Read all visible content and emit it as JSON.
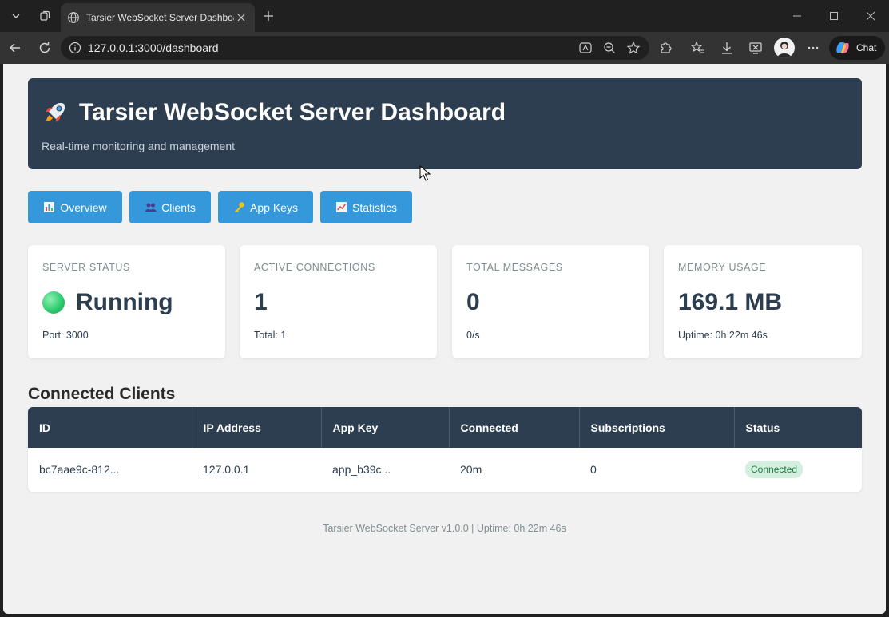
{
  "browser": {
    "tab_title": "Tarsier WebSocket Server Dashboard",
    "url": "127.0.0.1:3000/dashboard",
    "chat_label": "Chat"
  },
  "header": {
    "title": "Tarsier WebSocket Server Dashboard",
    "subtitle": "Real-time monitoring and management"
  },
  "nav": [
    {
      "label": "Overview",
      "icon": "bar-chart-icon"
    },
    {
      "label": "Clients",
      "icon": "users-icon"
    },
    {
      "label": "App Keys",
      "icon": "key-icon"
    },
    {
      "label": "Statistics",
      "icon": "trend-chart-icon"
    }
  ],
  "cards": [
    {
      "label": "SERVER STATUS",
      "value": "Running",
      "sub": "Port: 3000"
    },
    {
      "label": "ACTIVE CONNECTIONS",
      "value": "1",
      "sub": "Total: 1"
    },
    {
      "label": "TOTAL MESSAGES",
      "value": "0",
      "sub": "0/s"
    },
    {
      "label": "MEMORY USAGE",
      "value": "169.1 MB",
      "sub": "Uptime: 0h 22m 46s"
    }
  ],
  "clients": {
    "title": "Connected Clients",
    "columns": [
      "ID",
      "IP Address",
      "App Key",
      "Connected",
      "Subscriptions",
      "Status"
    ],
    "rows": [
      [
        "bc7aae9c-812...",
        "127.0.0.1",
        "app_b39c...",
        "20m",
        "0",
        "Connected"
      ]
    ]
  },
  "footer": "Tarsier WebSocket Server v1.0.0 | Uptime: 0h 22m 46s",
  "colors": {
    "header_bg": "#2d3e50",
    "nav_button": "#3498db",
    "status_ok": "#2ecc71",
    "badge_bg": "#d4efdf"
  }
}
